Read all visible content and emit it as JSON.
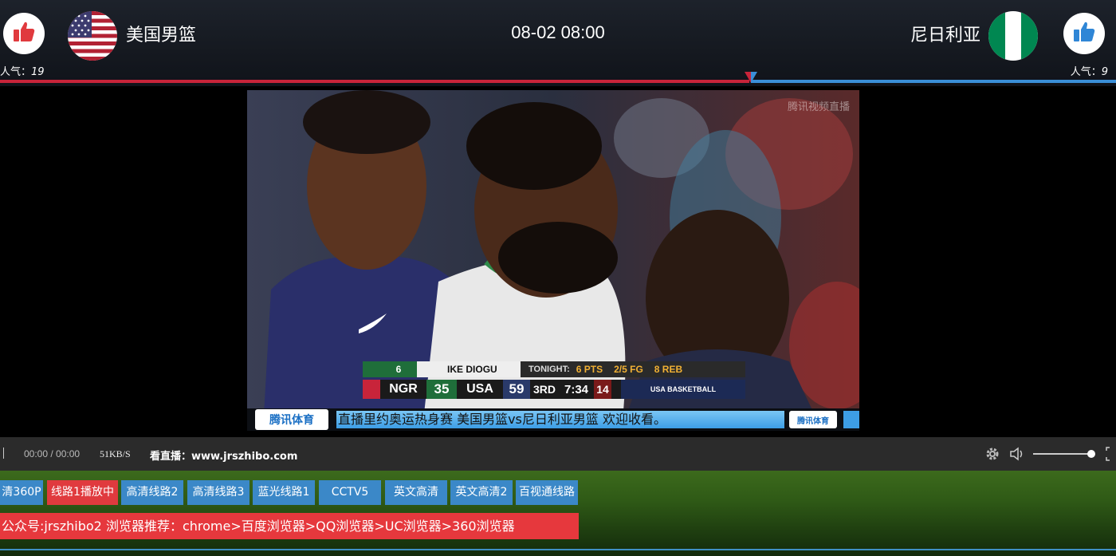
{
  "header": {
    "home_team": "美国男篮",
    "away_team": "尼日利亚",
    "match_time": "08-02 08:00",
    "popularity_label": "人气：",
    "home_popularity": "19",
    "away_popularity": "9",
    "home_share": 0.67,
    "colors": {
      "home": "#c8243a",
      "away": "#3a8fd8"
    }
  },
  "video": {
    "watermark": "腾讯视频直播",
    "scorebug": {
      "player_number": "6",
      "player_name_first": "IKE",
      "player_name_last": "DIOGU",
      "tonight_label": "TONIGHT:",
      "pts": "6 PTS",
      "fg": "2/5 FG",
      "reb": "8 REB",
      "team1": "NGR",
      "score1": "35",
      "team2": "USA",
      "score2": "59",
      "period": "3RD",
      "clock": "7:34",
      "shot_clock": "14",
      "brand": "USA BASKETBALL"
    },
    "ticker_logo": "腾讯体育",
    "ticker_text": "直播里约奥运热身赛 美国男篮vs尼日利亚男篮 欢迎收看。",
    "ticker_logo_small": "腾讯体育"
  },
  "controls": {
    "time": "00:00 / 00:00",
    "speed": "51KB/S",
    "live_label": "看直播：www.jrszhibo.com",
    "volume": 0.95,
    "icons": [
      "gear-icon",
      "volume-icon",
      "fullscreen-icon"
    ]
  },
  "lines": [
    {
      "label": "清360P",
      "active": false
    },
    {
      "label": "线路1播放中",
      "active": true
    },
    {
      "label": "高清线路2",
      "active": false
    },
    {
      "label": "高清线路3",
      "active": false
    },
    {
      "label": "蓝光线路1",
      "active": false
    },
    {
      "label": "CCTV5",
      "active": false
    },
    {
      "label": "英文高清",
      "active": false
    },
    {
      "label": "英文高清2",
      "active": false
    },
    {
      "label": "百视通线路",
      "active": false
    }
  ],
  "notice": "公众号:jrszhibo2 浏览器推荐：chrome>百度浏览器>QQ浏览器>UC浏览器>360浏览器"
}
